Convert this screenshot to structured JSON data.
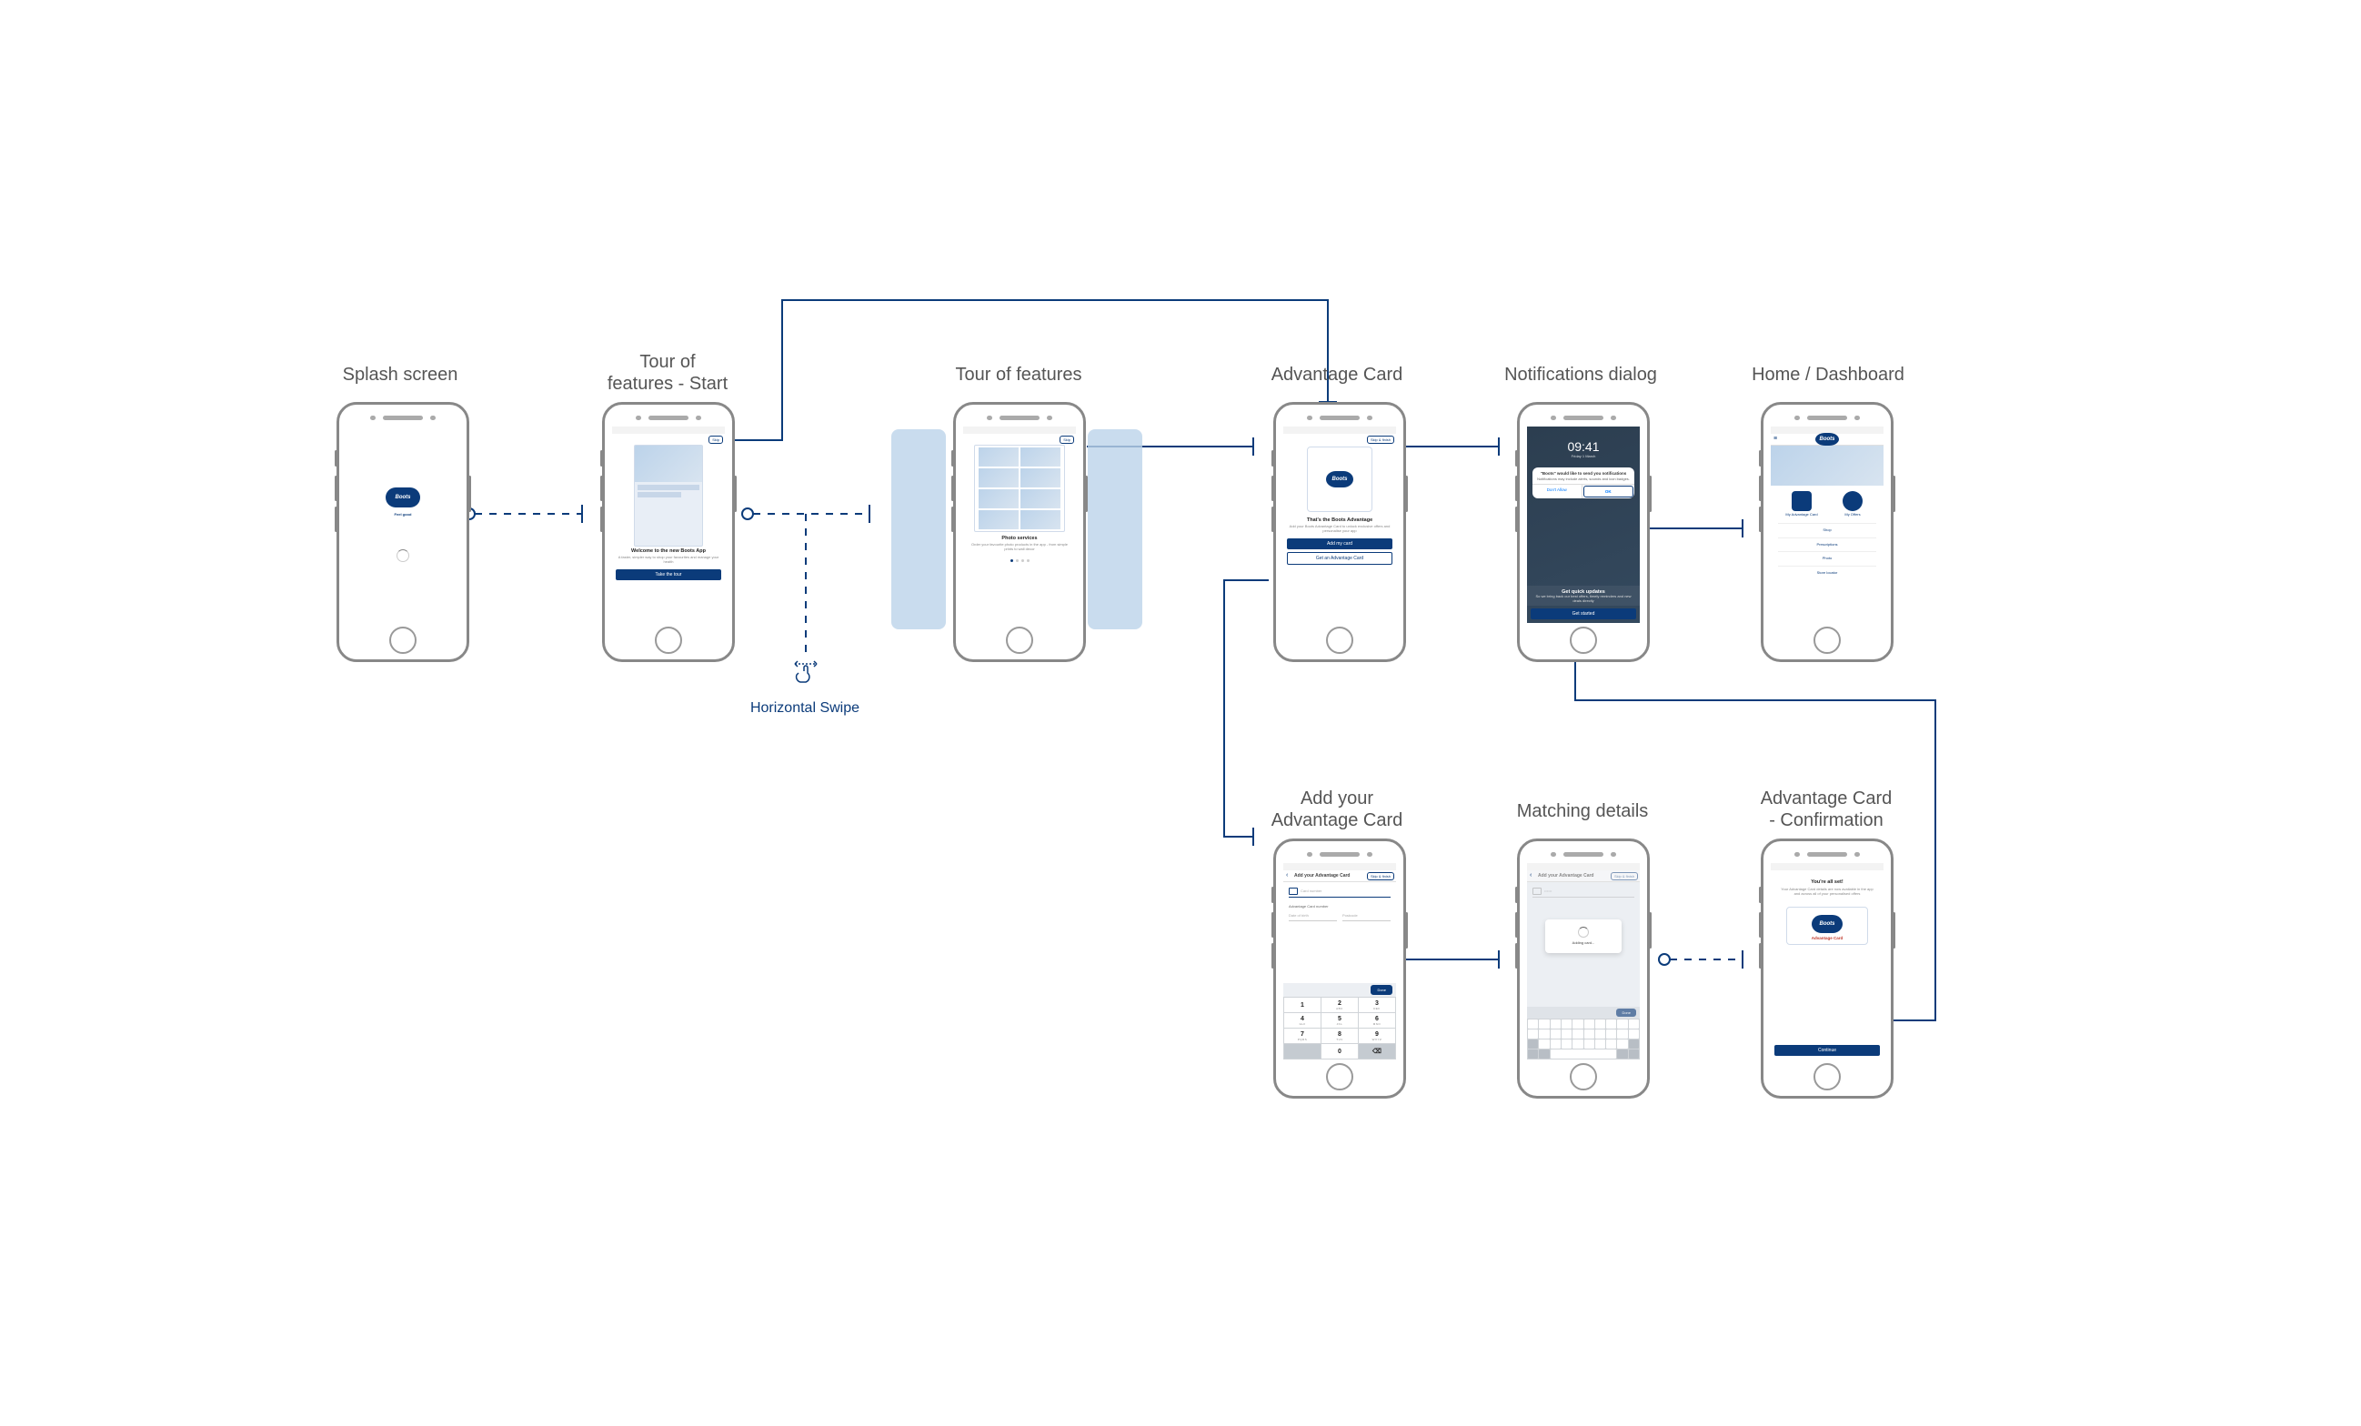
{
  "labels": {
    "splash": "Splash screen",
    "tour_start": "Tour of\nfeatures - Start",
    "tour": "Tour of features",
    "advantage": "Advantage Card",
    "notifications": "Notifications dialog",
    "home": "Home / Dashboard",
    "add_card": "Add your\nAdvantage Card",
    "matching": "Matching details",
    "confirm": "Advantage Card\n- Confirmation"
  },
  "swipe": "Horizontal Swipe",
  "brand": "Boots",
  "splash": {
    "tagline": "Feel good"
  },
  "tour_start": {
    "skip": "Skip",
    "welcome_title": "Welcome to the new Boots App",
    "welcome_sub": "A faster, simpler way to shop your favourites and manage your health",
    "cta": "Take the tour"
  },
  "tour": {
    "skip": "Skip",
    "title": "Photo services",
    "sub": "Order your favourite photo products in the app - from simple prints to wall decor"
  },
  "advantage": {
    "card_logo": "Boots",
    "skip": "Skip & finish",
    "heading": "That's the Boots Advantage",
    "sub": "Add your Boots Advantage Card to unlock exclusive offers and personalise your app",
    "add": "Add my card",
    "get": "Get an Advantage Card"
  },
  "notifications": {
    "time": "09:41",
    "date": "Friday 1 March",
    "dialog_title": "\"Boots\" would like to send you notifications",
    "dialog_body": "Notifications may include alerts, sounds and icon badges.",
    "deny": "Don't Allow",
    "allow": "OK",
    "heading": "Get quick updates",
    "sub": "So we bring back our best offers, timely reminders and new deals directly",
    "cta": "Get started"
  },
  "home": {
    "card_label": "My Advantage Card",
    "offers_label": "My Offers",
    "links": [
      "Shop",
      "Prescriptions",
      "Photo",
      "Store locator"
    ]
  },
  "add_card": {
    "skip": "Skip & finish",
    "title": "Add your Advantage Card",
    "field_card": "Card number",
    "section": "Advantage Card number",
    "field_dob": "Date of birth",
    "field_post": "Postcode",
    "done": "Done",
    "keys": [
      {
        "n": "1",
        "l": ""
      },
      {
        "n": "2",
        "l": "ABC"
      },
      {
        "n": "3",
        "l": "DEF"
      },
      {
        "n": "4",
        "l": "GHI"
      },
      {
        "n": "5",
        "l": "JKL"
      },
      {
        "n": "6",
        "l": "MNO"
      },
      {
        "n": "7",
        "l": "PQRS"
      },
      {
        "n": "8",
        "l": "TUV"
      },
      {
        "n": "9",
        "l": "WXYZ"
      },
      {
        "n": "",
        "l": ""
      },
      {
        "n": "0",
        "l": ""
      },
      {
        "n": "⌫",
        "l": ""
      }
    ]
  },
  "matching": {
    "skip": "Skip & finish",
    "title": "Add your Advantage Card",
    "status": "Adding card...",
    "done": "Done"
  },
  "confirm": {
    "heading": "You're all set!",
    "sub": "Your Advantage Card details are now available in the app and across all of your personalised offers",
    "card_text": "Advantage Card",
    "cta": "Continue"
  }
}
